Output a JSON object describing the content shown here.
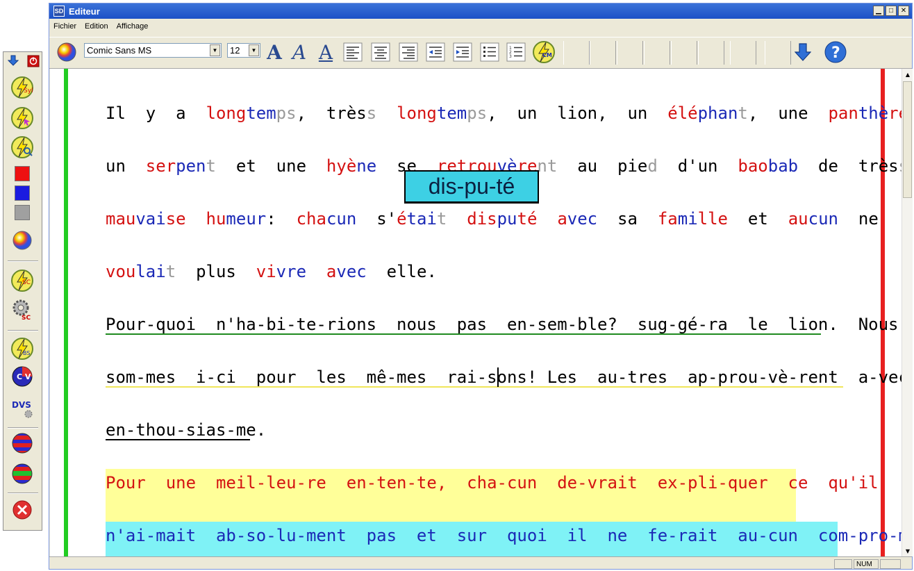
{
  "window": {
    "title": "Editeur",
    "app_icon_text": "SD"
  },
  "menu": {
    "items": [
      "Fichier",
      "Edition",
      "Affichage"
    ]
  },
  "toolbar": {
    "font_name": "Comic Sans MS",
    "font_size": "12",
    "bold_glyph": "A",
    "italic_glyph": "A",
    "underline_glyph": "A",
    "cm_label": "CM",
    "help_glyph": "?"
  },
  "palette": {
    "syl_label": "Syl",
    "sc_label": "SC",
    "sc2_label": "SC",
    "bs_label": "BS",
    "cv_label": "C V",
    "dvs_label": "DVS"
  },
  "colors": {
    "red_letters": "#d41111",
    "blue_letters": "#1b29b6",
    "silent_letters": "#9a9a9a",
    "left_margin": "#22cc22",
    "right_margin": "#e82020",
    "highlight_yellow": "#ffff99",
    "highlight_cyan": "#7ff2f6",
    "popup_bg": "#3dd0e4"
  },
  "document": {
    "popup": "dis-pu-té",
    "lines": [
      [
        [
          "Il",
          "k"
        ],
        [
          "  y  ",
          "k"
        ],
        [
          "a  ",
          "k"
        ],
        [
          "long",
          "r"
        ],
        [
          "tem",
          "b"
        ],
        [
          "ps",
          "g"
        ],
        [
          ",  très",
          "k"
        ],
        [
          "s",
          "g"
        ],
        [
          "  long",
          "r"
        ],
        [
          "tem",
          "b"
        ],
        [
          "ps",
          "g"
        ],
        [
          ",  un  lion,  un  ",
          "k"
        ],
        [
          "élé",
          "r"
        ],
        [
          "phan",
          "b"
        ],
        [
          "t",
          "g"
        ],
        [
          ",  une  ",
          "k"
        ],
        [
          "pan",
          "r"
        ],
        [
          "thè",
          "b"
        ],
        [
          "re",
          "r"
        ],
        [
          ",",
          "k"
        ]
      ],
      [
        [
          "un  ",
          "k"
        ],
        [
          "ser",
          "r"
        ],
        [
          "pen",
          "b"
        ],
        [
          "t",
          "g"
        ],
        [
          "  et  une  ",
          "k"
        ],
        [
          "hyè",
          "r"
        ],
        [
          "ne",
          "b"
        ],
        [
          "  se  ",
          "k"
        ],
        [
          "retrou",
          "r"
        ],
        [
          "vè",
          "b"
        ],
        [
          "re",
          "r"
        ],
        [
          "nt",
          "g"
        ],
        [
          "  au  pie",
          "k"
        ],
        [
          "d",
          "g"
        ],
        [
          "  d'un  ",
          "k"
        ],
        [
          "bao",
          "r"
        ],
        [
          "bab",
          "b"
        ],
        [
          "  de  très",
          "k"
        ],
        [
          "s",
          "g"
        ]
      ],
      [
        [
          "mau",
          "r"
        ],
        [
          "vai",
          "b"
        ],
        [
          "se",
          "r"
        ],
        [
          "  hu",
          "r"
        ],
        [
          "meur",
          "b"
        ],
        [
          ":  ",
          "k"
        ],
        [
          "cha",
          "r"
        ],
        [
          "cun",
          "b"
        ],
        [
          "  s'",
          "k"
        ],
        [
          "é",
          "r"
        ],
        [
          "tai",
          "b"
        ],
        [
          "t",
          "g"
        ],
        [
          "  dis",
          "r"
        ],
        [
          "pu",
          "b"
        ],
        [
          "té",
          "r"
        ],
        [
          "  a",
          "r"
        ],
        [
          "vec",
          "b"
        ],
        [
          "  sa  ",
          "k"
        ],
        [
          "fa",
          "r"
        ],
        [
          "mi",
          "b"
        ],
        [
          "lle",
          "r"
        ],
        [
          "  et  ",
          "k"
        ],
        [
          "au",
          "r"
        ],
        [
          "cun",
          "b"
        ],
        [
          "  ne",
          "k"
        ]
      ],
      [
        [
          "vou",
          "r"
        ],
        [
          "lai",
          "b"
        ],
        [
          "t",
          "g"
        ],
        [
          "  plus  ",
          "k"
        ],
        [
          "vi",
          "r"
        ],
        [
          "vre",
          "b"
        ],
        [
          "  a",
          "r"
        ],
        [
          "vec",
          "b"
        ],
        [
          "  elle.",
          "k"
        ]
      ],
      [
        [
          "Pour-quoi  n'ha-bi-te-rions  nous  pas  en-sem-ble?  sug-gé-ra  le  lion.  Nous",
          "k"
        ]
      ],
      [
        [
          "som-mes  i-ci  pour  les  mê-mes  rai-sons!",
          "k"
        ],
        [
          " Les  au-tres  ap-prou-vè-rent  a-vec",
          "k"
        ]
      ],
      [
        [
          "en-thou-sias-me.",
          "k"
        ]
      ],
      [
        [
          "Pour  une  meil-leu-re  en-ten-te,  cha-cun  de-vrait  ex-pli-quer  ce  qu'il",
          "r"
        ]
      ],
      [
        [
          "n'ai-mait  ab-so-lu-ment  pas  et  sur  quoi  il  ne  fe-rait  au-cun  com-pro-mis.",
          "b"
        ]
      ]
    ]
  },
  "status": {
    "num": "NUM"
  }
}
